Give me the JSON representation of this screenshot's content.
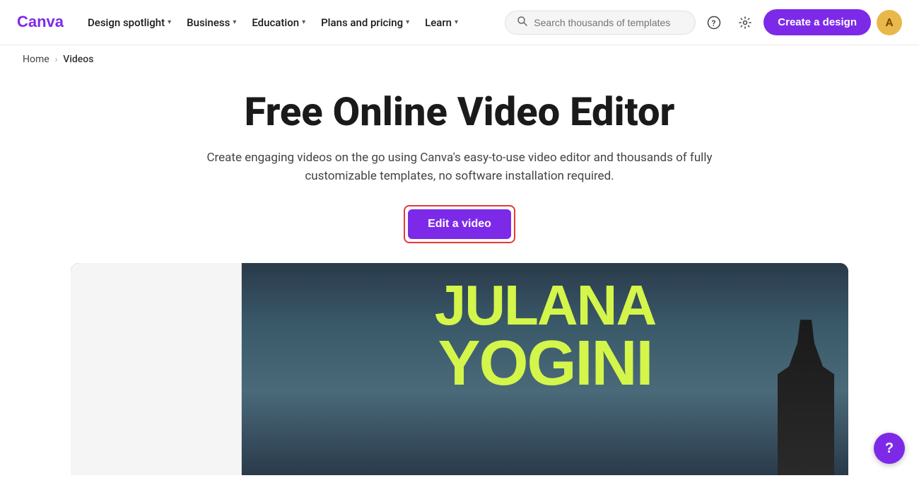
{
  "nav": {
    "logo_alt": "Canva",
    "items": [
      {
        "label": "Design spotlight",
        "has_dropdown": true
      },
      {
        "label": "Business",
        "has_dropdown": true
      },
      {
        "label": "Education",
        "has_dropdown": true
      },
      {
        "label": "Plans and pricing",
        "has_dropdown": true
      },
      {
        "label": "Learn",
        "has_dropdown": true
      }
    ],
    "search_placeholder": "Search thousands of templates",
    "create_label": "Create a design",
    "avatar_letter": "A"
  },
  "breadcrumb": {
    "home_label": "Home",
    "separator": "›",
    "current": "Videos"
  },
  "hero": {
    "title": "Free Online Video Editor",
    "subtitle": "Create engaging videos on the go using Canva's easy-to-use video editor and thousands of fully customizable templates, no software installation required.",
    "cta_label": "Edit a video"
  },
  "video_preview": {
    "title_line1": "JULANA",
    "title_line2": "YOGINI"
  },
  "help": {
    "label": "?"
  }
}
